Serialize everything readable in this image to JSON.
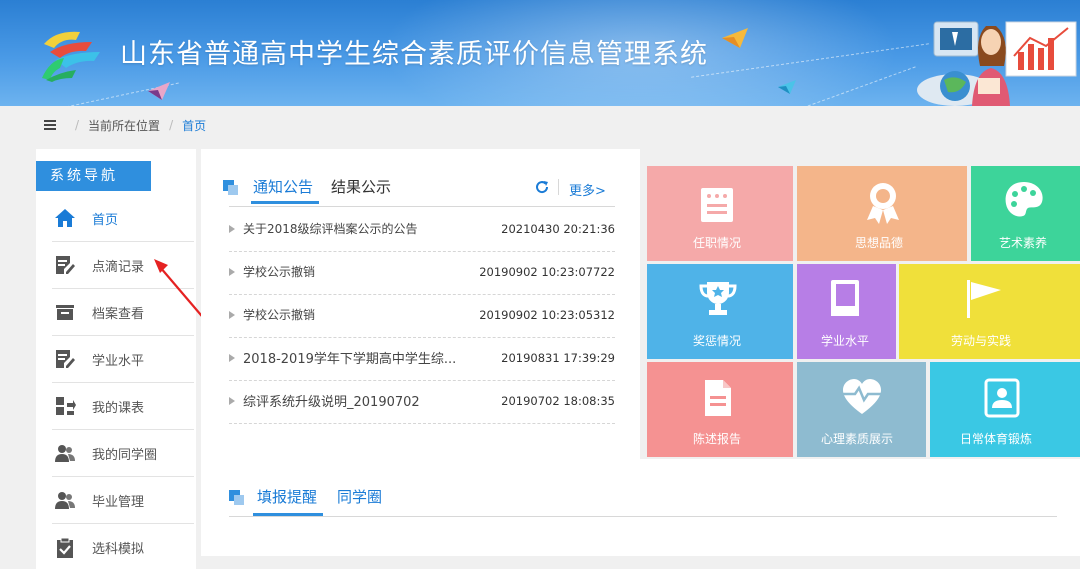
{
  "header": {
    "title": "山东省普通高中学生综合素质评价信息管理系统"
  },
  "breadcrumb": {
    "location_label": "当前所在位置",
    "current": "首页"
  },
  "sidebar": {
    "title": "系统导航",
    "items": [
      {
        "label": "首页",
        "icon": "home-icon",
        "active": true
      },
      {
        "label": "点滴记录",
        "icon": "edit-record-icon"
      },
      {
        "label": "档案查看",
        "icon": "archive-box-icon"
      },
      {
        "label": "学业水平",
        "icon": "edit-note-icon"
      },
      {
        "label": "我的课表",
        "icon": "schedule-icon"
      },
      {
        "label": "我的同学圈",
        "icon": "classmates-icon"
      },
      {
        "label": "毕业管理",
        "icon": "graduation-users-icon"
      },
      {
        "label": "选科模拟",
        "icon": "clipboard-check-icon"
      }
    ]
  },
  "notices": {
    "tabs": [
      "通知公告",
      "结果公示"
    ],
    "more_label": "更多>",
    "rows": [
      {
        "title": "关于2018级综评档案公示的公告",
        "time": "20210430 20:21:36"
      },
      {
        "title": "学校公示撤销",
        "time": "20190902 10:23:07722"
      },
      {
        "title": "学校公示撤销",
        "time": "20190902 10:23:05312"
      },
      {
        "title": "2018-2019学年下学期高中学生综...",
        "time": "20190831 17:39:29"
      },
      {
        "title": "综评系统升级说明_20190702",
        "time": "20190702 18:08:35"
      }
    ]
  },
  "reminders": {
    "tabs": [
      "填报提醒",
      "同学圈"
    ]
  },
  "tiles": [
    {
      "label": "任职情况",
      "color": "#f5a9a9"
    },
    {
      "label": "思想品德",
      "color": "#f4b58a"
    },
    {
      "label": "艺术素养",
      "color": "#3dd49a"
    },
    {
      "label": "奖惩情况",
      "color": "#4fb3e8"
    },
    {
      "label": "学业水平",
      "color": "#b77ee6"
    },
    {
      "label": "劳动与实践",
      "color": "#f0e03a"
    },
    {
      "label": "陈述报告",
      "color": "#f59292"
    },
    {
      "label": "心理素质展示",
      "color": "#8ebbd0"
    },
    {
      "label": "日常体育锻炼",
      "color": "#3ac8e4"
    }
  ]
}
